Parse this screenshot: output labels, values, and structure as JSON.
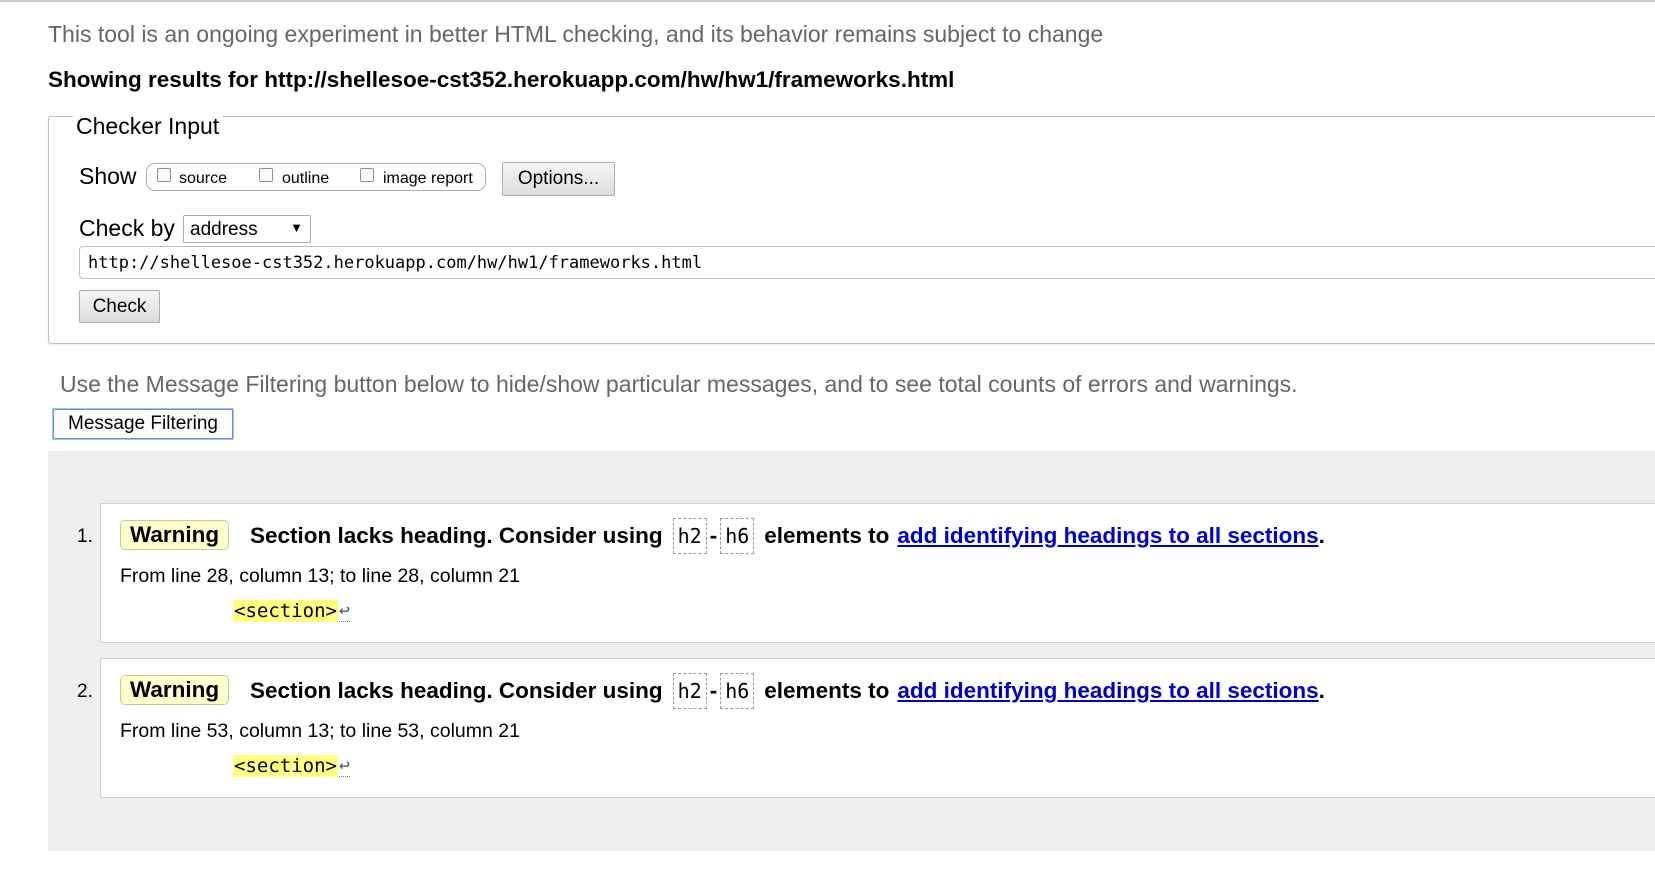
{
  "intro": "This tool is an ongoing experiment in better HTML checking, and its behavior remains subject to change",
  "results_for": "Showing results for http://shellesoe-cst352.herokuapp.com/hw/hw1/frameworks.html",
  "checker": {
    "legend": "Checker Input",
    "show_label": "Show",
    "show_options": [
      {
        "label": "source",
        "checked": false
      },
      {
        "label": "outline",
        "checked": false
      },
      {
        "label": "image report",
        "checked": false
      }
    ],
    "options_button": "Options...",
    "check_by_label": "Check by",
    "check_by_value": "address",
    "check_by_arrow": "▼",
    "url_value": "http://shellesoe-cst352.herokuapp.com/hw/hw1/frameworks.html",
    "check_button": "Check"
  },
  "filter_note": "Use the Message Filtering button below to hide/show particular messages, and to see total counts of errors and warnings.",
  "filter_button": "Message Filtering",
  "messages": [
    {
      "number": "1.",
      "type": "Warning",
      "text_before": "Section lacks heading. Consider using",
      "code_a": "h2",
      "dash": "-",
      "code_b": "h6",
      "text_mid": "elements to",
      "link": "add identifying headings to all sections",
      "period": ".",
      "location": "From line 28, column 13; to line 28, column 21",
      "extract": "<section>",
      "return_glyph": "↩"
    },
    {
      "number": "2.",
      "type": "Warning",
      "text_before": "Section lacks heading. Consider using",
      "code_a": "h2",
      "dash": "-",
      "code_b": "h6",
      "text_mid": "elements to",
      "link": "add identifying headings to all sections",
      "period": ".",
      "location": "From line 53, column 13; to line 53, column 21",
      "extract": "<section>",
      "return_glyph": "↩"
    }
  ]
}
